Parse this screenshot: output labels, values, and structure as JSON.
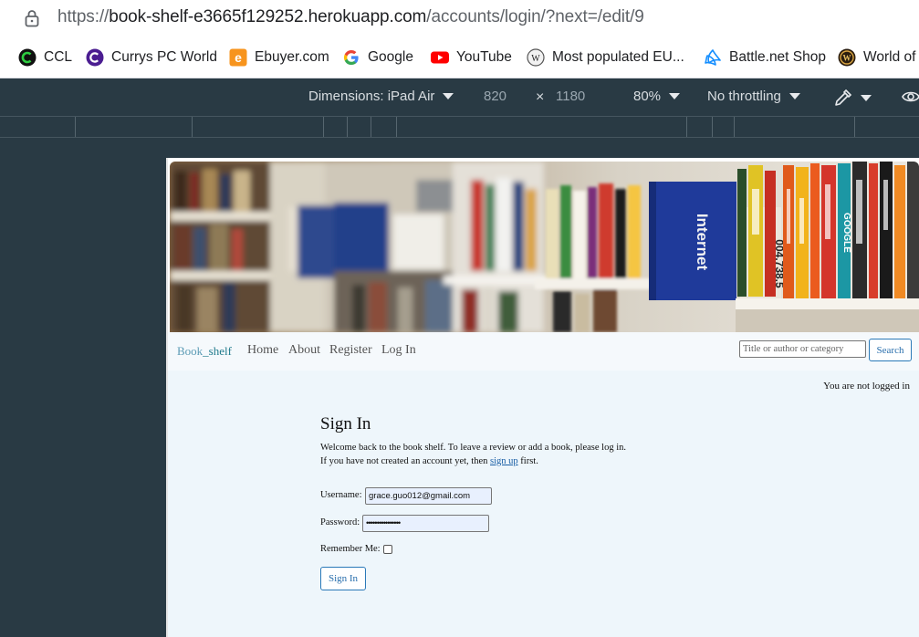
{
  "browser": {
    "url_prefix": "https://",
    "url_host": "book-shelf-e3665f129252.herokuapp.com",
    "url_path": "/accounts/login/?next=/edit/9",
    "bookmarks": [
      {
        "label": "CCL",
        "icon": "ccl-icon"
      },
      {
        "label": "Currys PC World",
        "icon": "currys-icon"
      },
      {
        "label": "Ebuyer.com",
        "icon": "ebuyer-icon"
      },
      {
        "label": "Google",
        "icon": "google-icon"
      },
      {
        "label": "YouTube",
        "icon": "youtube-icon"
      },
      {
        "label": "Most populated EU...",
        "icon": "wikipedia-icon"
      },
      {
        "label": "Battle.net Shop",
        "icon": "battlenet-icon"
      },
      {
        "label": "World of",
        "icon": "wow-icon"
      }
    ]
  },
  "devtools": {
    "dimensions_label": "Dimensions: iPad Air",
    "width": "820",
    "times": "×",
    "height": "1180",
    "zoom": "80%",
    "throttling": "No throttling"
  },
  "site": {
    "hero_book_labels": [
      "Internet",
      "004.738.5",
      "GOOGLE"
    ],
    "brand_part1": "Book",
    "brand_part2": "_shelf",
    "nav": [
      "Home",
      "About",
      "Register",
      "Log In"
    ],
    "search_placeholder": "Title or author or category",
    "search_button": "Search",
    "login_status": "You are not logged in",
    "signin_title": "Sign In",
    "welcome_line1": "Welcome back to the book shelf. To leave a review or add a book, please log in.",
    "welcome_line2_pre": "If you have not created an account yet, then ",
    "welcome_link": "sign up",
    "welcome_line2_post": " first.",
    "username_label": "Username:",
    "username_value": "grace.guo012@gmail.com",
    "password_label": "Password:",
    "password_value": "••••••••••••••••",
    "remember_label": "Remember Me:",
    "signin_button": "Sign In"
  },
  "colors": {
    "devtools_bg": "#293a44",
    "page_bg": "#eef6fb",
    "accent": "#2a6fad"
  }
}
